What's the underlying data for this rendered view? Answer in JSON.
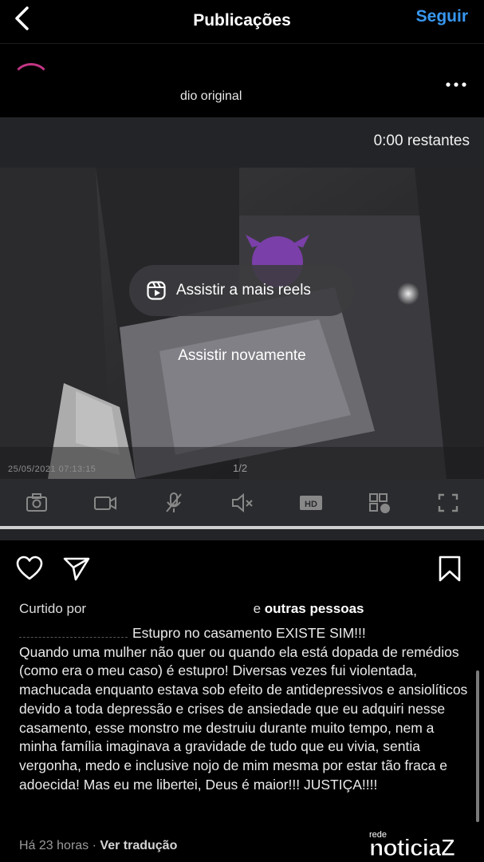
{
  "header": {
    "title": "Publicações",
    "follow_label": "Seguir"
  },
  "author": {
    "audio_label": "dio original"
  },
  "video": {
    "remaining": "0:00 restantes",
    "watch_more_reels": "Assistir a mais reels",
    "watch_again": "Assistir novamente",
    "pager": "1/2",
    "timestamp": "25/05/2021 07:13:15"
  },
  "post": {
    "liked_by_prefix": "Curtido por",
    "liked_by_suffix": "outras pessoas",
    "liked_by_joiner": "e",
    "caption": "Estupro no casamento EXISTE SIM!!!\nQuando uma mulher não quer ou quando ela está dopada de remédios (como era o meu caso) é estupro! Diversas vezes fui violentada, machucada enquanto estava sob efeito de antidepressivos e ansiolíticos devido a toda depressão e crises de ansiedade que eu adquiri nesse casamento, esse monstro me destruiu durante muito tempo, nem a minha família imaginava a gravidade de tudo que eu vivia, sentia vergonha, medo e inclusive nojo de mim mesma por estar tão fraca e adoecida! Mas eu me libertei, Deus é maior!!! JUSTIÇA!!!!",
    "time_ago": "Há 23 horas",
    "separator": "·",
    "translate": "Ver tradução"
  },
  "watermark": {
    "top": "rede",
    "main": "noticiaZ"
  },
  "icons": {
    "back": "chevron-left-icon",
    "more": "more-horizontal-icon",
    "like": "heart-icon",
    "share": "send-icon",
    "save": "bookmark-icon"
  },
  "colors": {
    "background": "#000000",
    "accent": "#3897f0",
    "text": "#ffffff",
    "muted": "#9a9a9a"
  }
}
